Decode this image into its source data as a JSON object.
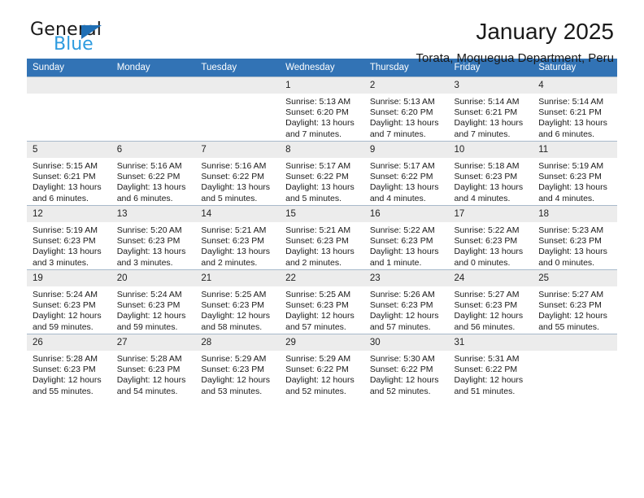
{
  "brand": {
    "name_part1": "General",
    "name_part2": "Blue",
    "triangle_color": "#1f6fb5",
    "blue_text_color": "#2e9bdf"
  },
  "header": {
    "month_title": "January 2025",
    "location": "Torata, Moquegua Department, Peru"
  },
  "theme": {
    "header_row_background": "#3273b5",
    "header_row_text": "#ffffff",
    "daynum_background": "#ececec",
    "cell_border": "#a8bacb"
  },
  "weekday_headers": [
    "Sunday",
    "Monday",
    "Tuesday",
    "Wednesday",
    "Thursday",
    "Friday",
    "Saturday"
  ],
  "weeks": [
    [
      {
        "day": "",
        "empty": true,
        "sunrise": "",
        "sunset": "",
        "daylight_line1": "",
        "daylight_line2": ""
      },
      {
        "day": "",
        "empty": true,
        "sunrise": "",
        "sunset": "",
        "daylight_line1": "",
        "daylight_line2": ""
      },
      {
        "day": "",
        "empty": true,
        "sunrise": "",
        "sunset": "",
        "daylight_line1": "",
        "daylight_line2": ""
      },
      {
        "day": "1",
        "empty": false,
        "sunrise": "Sunrise: 5:13 AM",
        "sunset": "Sunset: 6:20 PM",
        "daylight_line1": "Daylight: 13 hours",
        "daylight_line2": "and 7 minutes."
      },
      {
        "day": "2",
        "empty": false,
        "sunrise": "Sunrise: 5:13 AM",
        "sunset": "Sunset: 6:20 PM",
        "daylight_line1": "Daylight: 13 hours",
        "daylight_line2": "and 7 minutes."
      },
      {
        "day": "3",
        "empty": false,
        "sunrise": "Sunrise: 5:14 AM",
        "sunset": "Sunset: 6:21 PM",
        "daylight_line1": "Daylight: 13 hours",
        "daylight_line2": "and 7 minutes."
      },
      {
        "day": "4",
        "empty": false,
        "sunrise": "Sunrise: 5:14 AM",
        "sunset": "Sunset: 6:21 PM",
        "daylight_line1": "Daylight: 13 hours",
        "daylight_line2": "and 6 minutes."
      }
    ],
    [
      {
        "day": "5",
        "empty": false,
        "sunrise": "Sunrise: 5:15 AM",
        "sunset": "Sunset: 6:21 PM",
        "daylight_line1": "Daylight: 13 hours",
        "daylight_line2": "and 6 minutes."
      },
      {
        "day": "6",
        "empty": false,
        "sunrise": "Sunrise: 5:16 AM",
        "sunset": "Sunset: 6:22 PM",
        "daylight_line1": "Daylight: 13 hours",
        "daylight_line2": "and 6 minutes."
      },
      {
        "day": "7",
        "empty": false,
        "sunrise": "Sunrise: 5:16 AM",
        "sunset": "Sunset: 6:22 PM",
        "daylight_line1": "Daylight: 13 hours",
        "daylight_line2": "and 5 minutes."
      },
      {
        "day": "8",
        "empty": false,
        "sunrise": "Sunrise: 5:17 AM",
        "sunset": "Sunset: 6:22 PM",
        "daylight_line1": "Daylight: 13 hours",
        "daylight_line2": "and 5 minutes."
      },
      {
        "day": "9",
        "empty": false,
        "sunrise": "Sunrise: 5:17 AM",
        "sunset": "Sunset: 6:22 PM",
        "daylight_line1": "Daylight: 13 hours",
        "daylight_line2": "and 4 minutes."
      },
      {
        "day": "10",
        "empty": false,
        "sunrise": "Sunrise: 5:18 AM",
        "sunset": "Sunset: 6:23 PM",
        "daylight_line1": "Daylight: 13 hours",
        "daylight_line2": "and 4 minutes."
      },
      {
        "day": "11",
        "empty": false,
        "sunrise": "Sunrise: 5:19 AM",
        "sunset": "Sunset: 6:23 PM",
        "daylight_line1": "Daylight: 13 hours",
        "daylight_line2": "and 4 minutes."
      }
    ],
    [
      {
        "day": "12",
        "empty": false,
        "sunrise": "Sunrise: 5:19 AM",
        "sunset": "Sunset: 6:23 PM",
        "daylight_line1": "Daylight: 13 hours",
        "daylight_line2": "and 3 minutes."
      },
      {
        "day": "13",
        "empty": false,
        "sunrise": "Sunrise: 5:20 AM",
        "sunset": "Sunset: 6:23 PM",
        "daylight_line1": "Daylight: 13 hours",
        "daylight_line2": "and 3 minutes."
      },
      {
        "day": "14",
        "empty": false,
        "sunrise": "Sunrise: 5:21 AM",
        "sunset": "Sunset: 6:23 PM",
        "daylight_line1": "Daylight: 13 hours",
        "daylight_line2": "and 2 minutes."
      },
      {
        "day": "15",
        "empty": false,
        "sunrise": "Sunrise: 5:21 AM",
        "sunset": "Sunset: 6:23 PM",
        "daylight_line1": "Daylight: 13 hours",
        "daylight_line2": "and 2 minutes."
      },
      {
        "day": "16",
        "empty": false,
        "sunrise": "Sunrise: 5:22 AM",
        "sunset": "Sunset: 6:23 PM",
        "daylight_line1": "Daylight: 13 hours",
        "daylight_line2": "and 1 minute."
      },
      {
        "day": "17",
        "empty": false,
        "sunrise": "Sunrise: 5:22 AM",
        "sunset": "Sunset: 6:23 PM",
        "daylight_line1": "Daylight: 13 hours",
        "daylight_line2": "and 0 minutes."
      },
      {
        "day": "18",
        "empty": false,
        "sunrise": "Sunrise: 5:23 AM",
        "sunset": "Sunset: 6:23 PM",
        "daylight_line1": "Daylight: 13 hours",
        "daylight_line2": "and 0 minutes."
      }
    ],
    [
      {
        "day": "19",
        "empty": false,
        "sunrise": "Sunrise: 5:24 AM",
        "sunset": "Sunset: 6:23 PM",
        "daylight_line1": "Daylight: 12 hours",
        "daylight_line2": "and 59 minutes."
      },
      {
        "day": "20",
        "empty": false,
        "sunrise": "Sunrise: 5:24 AM",
        "sunset": "Sunset: 6:23 PM",
        "daylight_line1": "Daylight: 12 hours",
        "daylight_line2": "and 59 minutes."
      },
      {
        "day": "21",
        "empty": false,
        "sunrise": "Sunrise: 5:25 AM",
        "sunset": "Sunset: 6:23 PM",
        "daylight_line1": "Daylight: 12 hours",
        "daylight_line2": "and 58 minutes."
      },
      {
        "day": "22",
        "empty": false,
        "sunrise": "Sunrise: 5:25 AM",
        "sunset": "Sunset: 6:23 PM",
        "daylight_line1": "Daylight: 12 hours",
        "daylight_line2": "and 57 minutes."
      },
      {
        "day": "23",
        "empty": false,
        "sunrise": "Sunrise: 5:26 AM",
        "sunset": "Sunset: 6:23 PM",
        "daylight_line1": "Daylight: 12 hours",
        "daylight_line2": "and 57 minutes."
      },
      {
        "day": "24",
        "empty": false,
        "sunrise": "Sunrise: 5:27 AM",
        "sunset": "Sunset: 6:23 PM",
        "daylight_line1": "Daylight: 12 hours",
        "daylight_line2": "and 56 minutes."
      },
      {
        "day": "25",
        "empty": false,
        "sunrise": "Sunrise: 5:27 AM",
        "sunset": "Sunset: 6:23 PM",
        "daylight_line1": "Daylight: 12 hours",
        "daylight_line2": "and 55 minutes."
      }
    ],
    [
      {
        "day": "26",
        "empty": false,
        "sunrise": "Sunrise: 5:28 AM",
        "sunset": "Sunset: 6:23 PM",
        "daylight_line1": "Daylight: 12 hours",
        "daylight_line2": "and 55 minutes."
      },
      {
        "day": "27",
        "empty": false,
        "sunrise": "Sunrise: 5:28 AM",
        "sunset": "Sunset: 6:23 PM",
        "daylight_line1": "Daylight: 12 hours",
        "daylight_line2": "and 54 minutes."
      },
      {
        "day": "28",
        "empty": false,
        "sunrise": "Sunrise: 5:29 AM",
        "sunset": "Sunset: 6:23 PM",
        "daylight_line1": "Daylight: 12 hours",
        "daylight_line2": "and 53 minutes."
      },
      {
        "day": "29",
        "empty": false,
        "sunrise": "Sunrise: 5:29 AM",
        "sunset": "Sunset: 6:22 PM",
        "daylight_line1": "Daylight: 12 hours",
        "daylight_line2": "and 52 minutes."
      },
      {
        "day": "30",
        "empty": false,
        "sunrise": "Sunrise: 5:30 AM",
        "sunset": "Sunset: 6:22 PM",
        "daylight_line1": "Daylight: 12 hours",
        "daylight_line2": "and 52 minutes."
      },
      {
        "day": "31",
        "empty": false,
        "sunrise": "Sunrise: 5:31 AM",
        "sunset": "Sunset: 6:22 PM",
        "daylight_line1": "Daylight: 12 hours",
        "daylight_line2": "and 51 minutes."
      },
      {
        "day": "",
        "empty": true,
        "sunrise": "",
        "sunset": "",
        "daylight_line1": "",
        "daylight_line2": ""
      }
    ]
  ]
}
